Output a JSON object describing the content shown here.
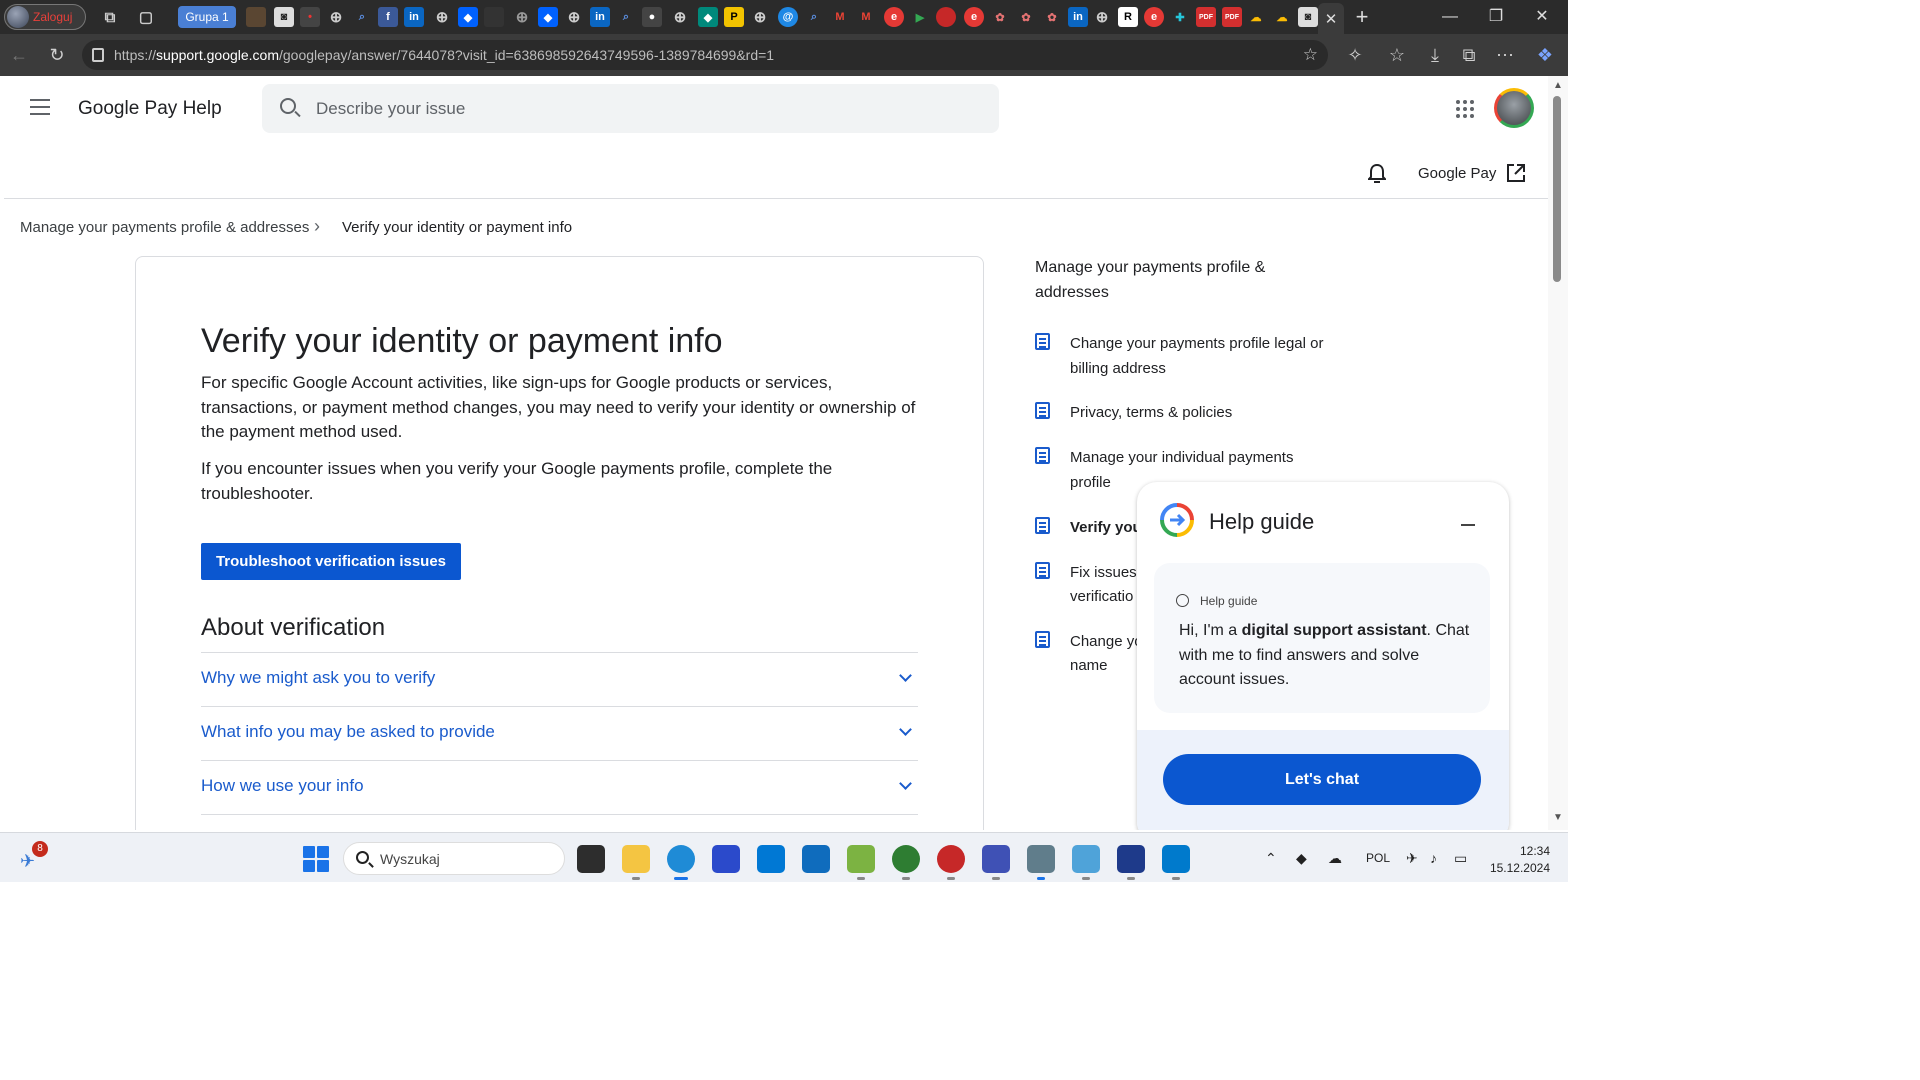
{
  "browser": {
    "profile_label": "Zaloguj",
    "tab_group": "Grupa 1",
    "close_tab": "✕",
    "new_tab": "+",
    "url_prefix": "https://",
    "url_domain": "support.google.com",
    "url_path": "/googlepay/answer/7644078?visit_id=638698592643749596-1389784699&rd=1"
  },
  "header": {
    "app_title": "Google Pay Help",
    "search_placeholder": "Describe your issue",
    "gpay_link": "Google Pay"
  },
  "breadcrumb": {
    "parent": "Manage your payments profile & addresses",
    "separator": "›",
    "current": "Verify your identity or payment info"
  },
  "article": {
    "title": "Verify your identity or payment info",
    "paragraph1": "For specific Google Account activities, like sign-ups for Google products or services, transactions, or payment method changes, you may need to verify your identity or ownership of the payment method used.",
    "paragraph2": "If you encounter issues when you verify your Google payments profile, complete the troubleshooter.",
    "button": "Troubleshoot verification issues",
    "section_title": "About verification",
    "accordion": [
      "Why we might ask you to verify",
      "What info you may be asked to provide",
      "How we use your info"
    ]
  },
  "sidebar": {
    "title": "Manage your payments profile & addresses",
    "items": [
      "Change your payments profile legal or billing address",
      "Privacy, terms & policies",
      "Manage your individual payments profile",
      "Verify you",
      "Fix issues",
      "verificatio",
      "Change yo",
      "name"
    ]
  },
  "help_guide": {
    "title": "Help guide",
    "card_label": "Help guide",
    "message_pre": "Hi, I'm a ",
    "message_bold": "digital support assistant",
    "message_post": ". Chat with me to find answers and solve account issues.",
    "chat_button": "Let's chat"
  },
  "taskbar": {
    "notification_count": "8",
    "search_placeholder": "Wyszukaj",
    "language": "POL",
    "time": "12:34",
    "date": "15.12.2024"
  },
  "colors": {
    "accent": "#0b57d0",
    "link": "#1a5bcc",
    "chrome_dark": "#2b2b2b"
  }
}
